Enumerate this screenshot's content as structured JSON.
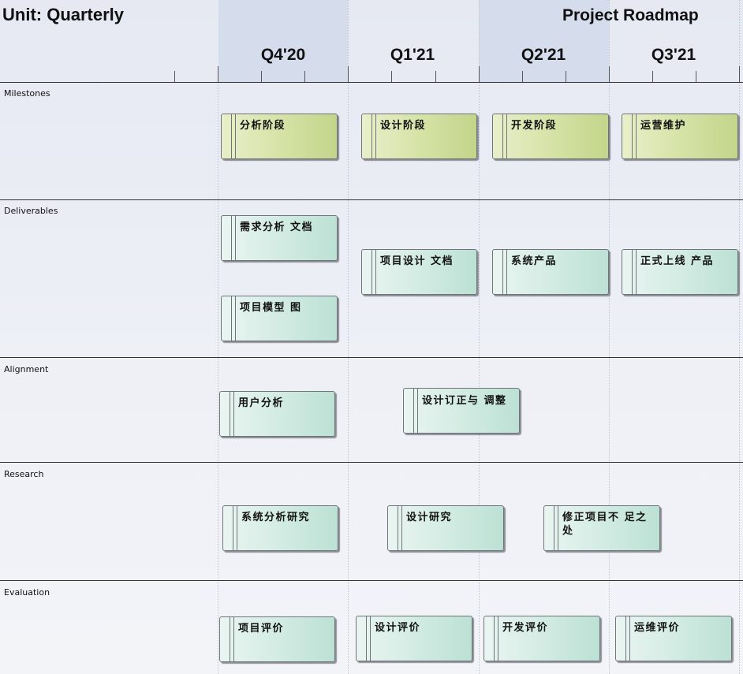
{
  "header": {
    "unit_label": "Unit: Quarterly",
    "title": "Project Roadmap"
  },
  "quarters": [
    "Q4'20",
    "Q1'21",
    "Q2'21",
    "Q3'21"
  ],
  "lanes": [
    "Milestones",
    "Deliverables",
    "Alignment",
    "Research",
    "Evaluation"
  ],
  "cards": {
    "milestones": [
      "分析阶段",
      "设计阶段",
      "开发阶段",
      "运营维护"
    ],
    "deliverables": [
      "需求分析 文档",
      "项目模型 图",
      "项目设计 文档",
      "系统产品",
      "正式上线 产品"
    ],
    "alignment": [
      "用户分析",
      "设计订正与 调整"
    ],
    "research": [
      "系统分析研究",
      "设计研究",
      "修正项目不 足之处"
    ],
    "evaluation": [
      "项目评价",
      "设计评价",
      "开发评价",
      "运维评价"
    ]
  },
  "colors": {
    "milestone_fill": "#d6e3a7",
    "card_fill": "#d3ece3",
    "header_band": "#d5dcec",
    "background": "#eef0f6"
  }
}
